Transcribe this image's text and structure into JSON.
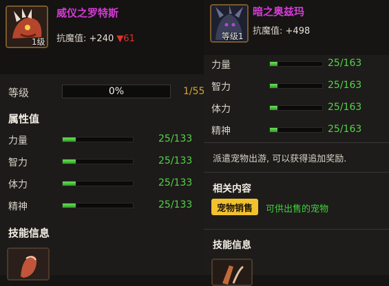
{
  "left": {
    "pet_name": "威仪之罗特斯",
    "portrait_level": "1级",
    "resist_label": "抗魔值:",
    "resist_value": "+240",
    "resist_down_arrow": "▼",
    "resist_down_value": "61",
    "level_label": "等级",
    "level_progress": "0%",
    "level_progress_fraction": 0,
    "level_count": "1/55",
    "attributes_title": "属性值",
    "stats": [
      {
        "label": "力量",
        "value": "25/133",
        "fill": 0.19
      },
      {
        "label": "智力",
        "value": "25/133",
        "fill": 0.19
      },
      {
        "label": "体力",
        "value": "25/133",
        "fill": 0.19
      },
      {
        "label": "精神",
        "value": "25/133",
        "fill": 0.19
      }
    ],
    "skills_title": "技能信息"
  },
  "right": {
    "pet_name": "暗之奥兹玛",
    "portrait_level": "等级1",
    "resist_label": "抗魔值:",
    "resist_value": "+498",
    "stats": [
      {
        "label": "力量",
        "value": "25/163",
        "fill": 0.15
      },
      {
        "label": "智力",
        "value": "25/163",
        "fill": 0.15
      },
      {
        "label": "体力",
        "value": "25/163",
        "fill": 0.15
      },
      {
        "label": "精神",
        "value": "25/163",
        "fill": 0.15
      }
    ],
    "description": "派遣宠物出游, 可以获得追加奖励.",
    "related_title": "相关内容",
    "related_tag": "宠物销售",
    "related_text": "可供出售的宠物",
    "skills_title": "技能信息"
  },
  "colors": {
    "pet_name": "#d53bd6",
    "stat_value": "#56d34a",
    "tag_button": "#f2c12e",
    "down_arrow": "#e0332a"
  },
  "icons": {
    "left_portrait": "red-beast-portrait-icon",
    "right_portrait": "dark-ozma-portrait-icon",
    "left_skill": "skill-icon",
    "right_skill": "skill-icon"
  }
}
